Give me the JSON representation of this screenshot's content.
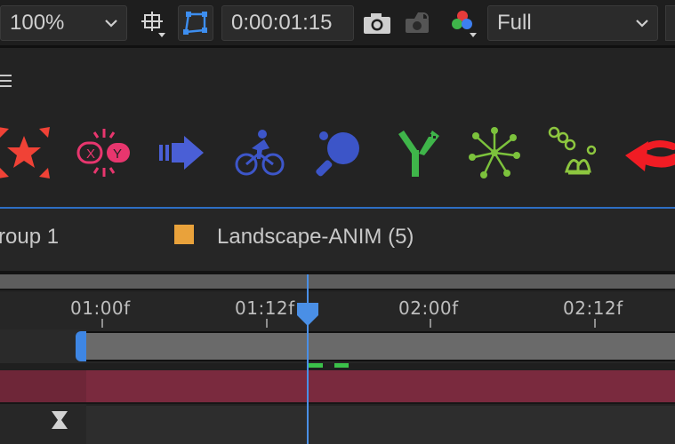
{
  "viewer_toolbar": {
    "zoom": "100%",
    "timecode": "0:00:01:15",
    "resolution": "Full",
    "icons": [
      "grid-icon",
      "mask-region-icon",
      "camera-icon",
      "show-snapshot-icon",
      "rgb-channels-icon"
    ]
  },
  "panel": {
    "menu_icon": "hamburger-icon",
    "presets": [
      {
        "name": "explode-star-icon",
        "color": "#f04236"
      },
      {
        "name": "xy-split-icon",
        "color": "#e8366e"
      },
      {
        "name": "slide-arrow-icon",
        "color": "#4a5fd6"
      },
      {
        "name": "cyclist-icon",
        "color": "#3d56c9"
      },
      {
        "name": "ping-pong-icon",
        "color": "#3c55c8"
      },
      {
        "name": "branch-tree-icon",
        "color": "#3fb54a"
      },
      {
        "name": "burst-dots-icon",
        "color": "#7cc23c"
      },
      {
        "name": "sprout-bubbles-icon",
        "color": "#8dc63f"
      },
      {
        "name": "curved-arrow-icon",
        "color": "#f11c24"
      }
    ]
  },
  "tabs": {
    "group_tab": "roup 1",
    "comp_tab": "Landscape-ANIM (5)",
    "comp_color": "#e9a23b"
  },
  "timeline": {
    "ruler_labels": [
      "01:00f",
      "01:12f",
      "02:00f",
      "02:12f"
    ],
    "current_time": "0:00:01:15"
  }
}
